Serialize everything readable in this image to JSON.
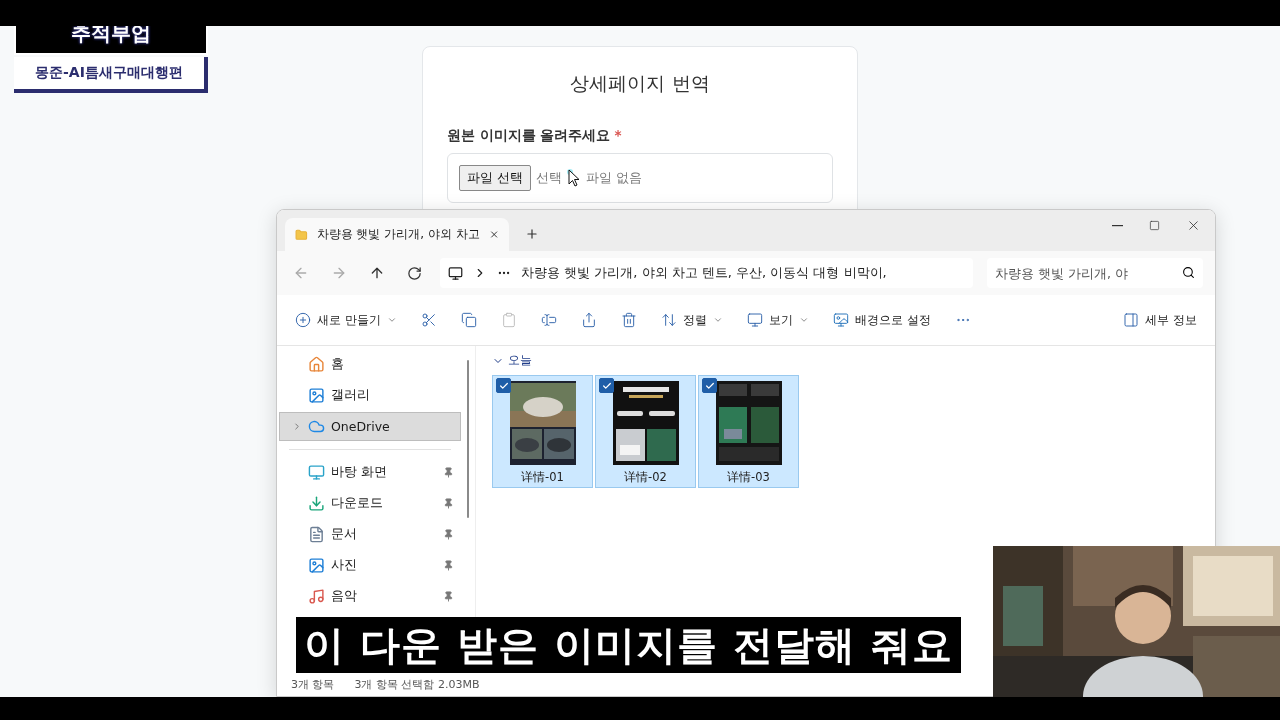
{
  "channel_badge": {
    "title": "추적부업",
    "subtitle": "몽준-AI틈새구매대행편"
  },
  "web_form": {
    "title": "상세페이지 번역",
    "field_label": "원본 이미지를 올려주세요",
    "required_mark": "*",
    "file_button": "파일 선택",
    "status_start": "선택",
    "status_end": "파일 없음"
  },
  "explorer": {
    "tab_title": "차량용 햇빛 가리개, 야외 차고",
    "address_path": "차량용 햇빛 가리개, 야외 차고 텐트, 우산, 이동식 대형 비막이,",
    "search": {
      "placeholder": "차량용 햇빛 가리개, 야"
    },
    "toolbar": [
      {
        "kind": "new",
        "label": "새로 만들기",
        "disabled": false
      },
      {
        "kind": "cut",
        "disabled": false
      },
      {
        "kind": "copy",
        "disabled": false
      },
      {
        "kind": "paste",
        "disabled": true
      },
      {
        "kind": "rename",
        "disabled": false
      },
      {
        "kind": "share",
        "disabled": false
      },
      {
        "kind": "delete",
        "disabled": false
      },
      {
        "kind": "sort",
        "label": "정렬",
        "disabled": false
      },
      {
        "kind": "view",
        "label": "보기",
        "disabled": false
      },
      {
        "kind": "wallpaper",
        "label": "배경으로 설정",
        "disabled": false
      },
      {
        "kind": "more",
        "disabled": false
      },
      {
        "kind": "details",
        "label": "세부 정보",
        "disabled": false
      }
    ],
    "sidebar": [
      {
        "kind": "home",
        "label": "홈",
        "selected": false,
        "pinned": false
      },
      {
        "kind": "gallery",
        "label": "갤러리",
        "selected": false,
        "pinned": false
      },
      {
        "kind": "cloud",
        "label": "OneDrive",
        "selected": true,
        "pinned": false
      },
      {
        "kind": "divider"
      },
      {
        "kind": "desktop",
        "label": "바탕 화면",
        "selected": false,
        "pinned": true
      },
      {
        "kind": "downloads",
        "label": "다운로드",
        "selected": false,
        "pinned": true
      },
      {
        "kind": "documents",
        "label": "문서",
        "selected": false,
        "pinned": true
      },
      {
        "kind": "pictures",
        "label": "사진",
        "selected": false,
        "pinned": true
      },
      {
        "kind": "music",
        "label": "음악",
        "selected": false,
        "pinned": true
      }
    ],
    "group": {
      "label": "오늘",
      "expanded": true
    },
    "files": [
      {
        "name": "详情-01",
        "selected": true
      },
      {
        "name": "详情-02",
        "selected": true
      },
      {
        "name": "详情-03",
        "selected": true
      }
    ],
    "status_bar": {
      "count": "3개 항목",
      "selection": "3개 항목 선택함 2.03MB"
    }
  },
  "subtitle": "이 다운 받은 이미지를 전달해 줘요"
}
